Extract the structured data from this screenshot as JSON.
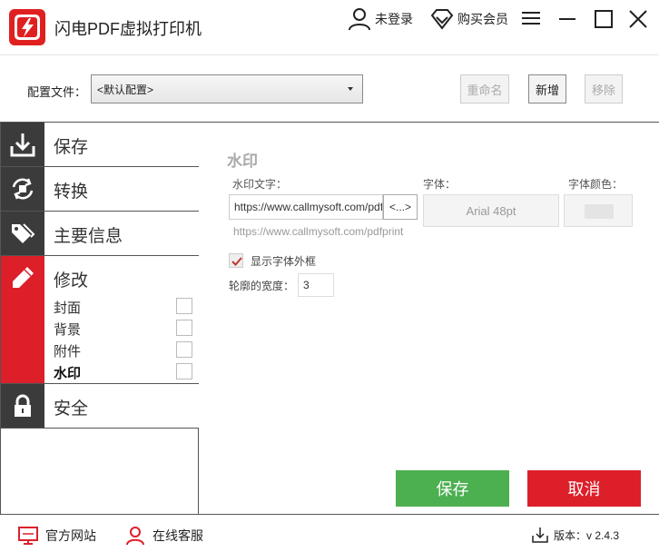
{
  "app": {
    "title": "闪电PDF虚拟打印机",
    "login_label": "未登录",
    "vip_label": "购买会员",
    "brand_color": "#dd1f2a"
  },
  "config": {
    "label": "配置文件：",
    "selected": "<默认配置>",
    "rename_label": "重命名",
    "new_label": "新增",
    "remove_label": "移除"
  },
  "sidebar": {
    "items": [
      {
        "label": "保存",
        "icon": "download-icon"
      },
      {
        "label": "转换",
        "icon": "convert-icon"
      },
      {
        "label": "主要信息",
        "icon": "tag-icon"
      },
      {
        "label": "修改",
        "icon": "pencil-icon"
      },
      {
        "label": "安全",
        "icon": "lock-icon"
      }
    ],
    "sub_items": [
      {
        "label": "封面"
      },
      {
        "label": "背景"
      },
      {
        "label": "附件"
      },
      {
        "label": "水印"
      }
    ]
  },
  "watermark": {
    "section_title": "水印",
    "text_label": "水印文字：",
    "text_value": "https://www.callmysoft.com/pdfprint",
    "macro_label": "<...>",
    "font_label": "字体：",
    "font_value": "Arial 48pt",
    "font_color_label": "字体颜色：",
    "hint": "https://www.callmysoft.com/pdfprint",
    "outline_label": "显示字体外框",
    "outline_checked": true,
    "outline_width_label": "轮廓的宽度：",
    "outline_width_value": "3"
  },
  "actions": {
    "save_label": "保存",
    "cancel_label": "取消",
    "save_color": "#4caf50",
    "cancel_color": "#dd1f2a"
  },
  "footer": {
    "website_label": "官方网站",
    "service_label": "在线客服",
    "version_label": "版本：v 2.4.3"
  }
}
